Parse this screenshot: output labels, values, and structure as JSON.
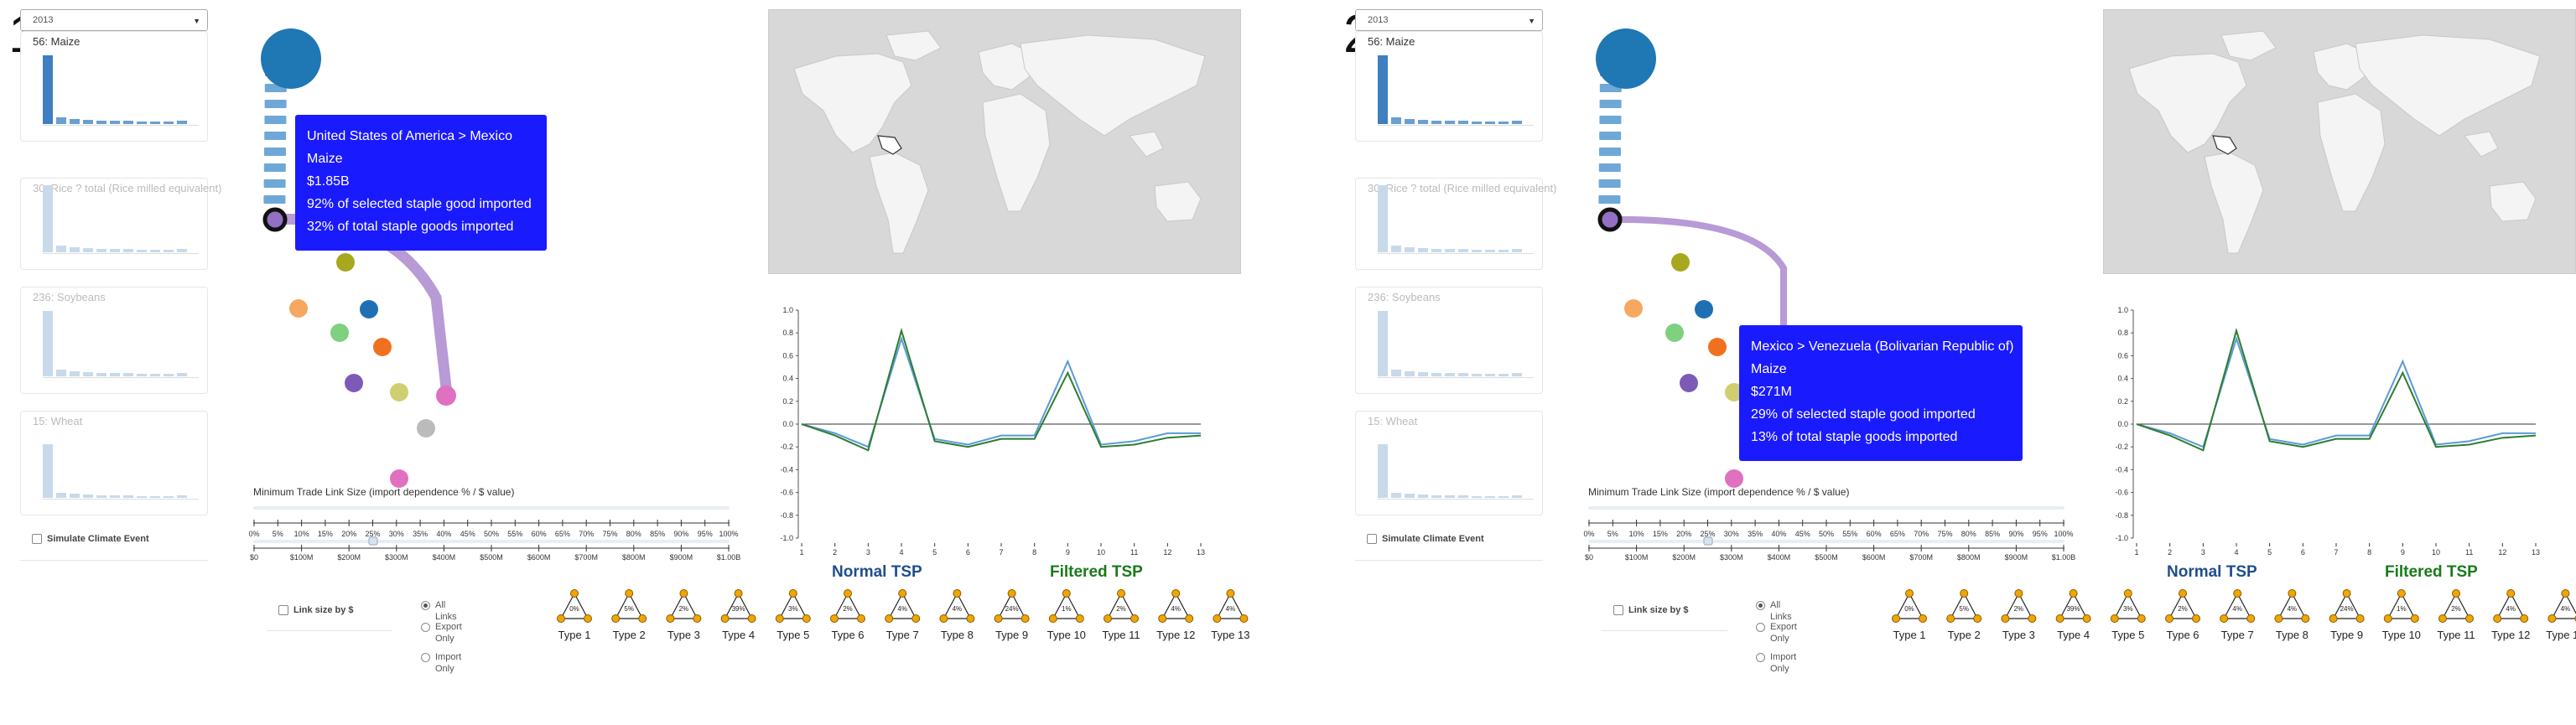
{
  "panels": [
    {
      "number": "1",
      "year": "2013",
      "crops": [
        {
          "label": "56: Maize",
          "active": true
        },
        {
          "label": "30: Rice ? total (Rice milled equivalent)",
          "active": false
        },
        {
          "label": "236: Soybeans",
          "active": false
        },
        {
          "label": "15: Wheat",
          "active": false
        }
      ],
      "simulate_label": "Simulate Climate Event",
      "tooltip": {
        "route": "United States of America > Mexico",
        "crop": "Maize",
        "value": "$1.85B",
        "pct_selected": "92% of selected staple good imported",
        "pct_total": "32% of total staple goods imported"
      }
    },
    {
      "number": "2",
      "year": "2013",
      "crops": [
        {
          "label": "56: Maize",
          "active": true
        },
        {
          "label": "30: Rice ? total (Rice milled equivalent)",
          "active": false
        },
        {
          "label": "236: Soybeans",
          "active": false
        },
        {
          "label": "15: Wheat",
          "active": false
        }
      ],
      "simulate_label": "Simulate Climate Event",
      "tooltip": {
        "route": "Mexico > Venezuela (Bolivarian Republic of)",
        "crop": "Maize",
        "value": "$271M",
        "pct_selected": "29% of selected staple good imported",
        "pct_total": "13% of total staple goods imported"
      }
    }
  ],
  "slider": {
    "title": "Minimum Trade Link Size (import dependence % / $ value)",
    "pct_ticks": [
      "0%",
      "5%",
      "10%",
      "15%",
      "20%",
      "25%",
      "30%",
      "35%",
      "40%",
      "45%",
      "50%",
      "55%",
      "60%",
      "65%",
      "70%",
      "75%",
      "80%",
      "85%",
      "90%",
      "95%",
      "100%"
    ],
    "dollar_ticks": [
      "$0",
      "$100M",
      "$200M",
      "$300M",
      "$400M",
      "$500M",
      "$600M",
      "$700M",
      "$800M",
      "$900M",
      "$1.00B"
    ]
  },
  "link_size_label": "Link size by $",
  "link_filter": {
    "options": [
      "All Links",
      "Export Only",
      "Import Only"
    ],
    "selected": "All Links"
  },
  "tsp_titles": {
    "normal": "Normal TSP",
    "filtered": "Filtered TSP"
  },
  "colors": {
    "normal_title": "#1f4e8c",
    "filtered_title": "#1a7a1a",
    "tooltip_bg": "#1a1aff",
    "maize_node": "#1f77b4",
    "flow_link": "#b89ad6",
    "line_normal": "#5b9bd5",
    "line_filtered": "#2e7d32"
  },
  "motif_types": [
    {
      "label": "Type 1",
      "pct": "0%"
    },
    {
      "label": "Type 2",
      "pct": "5%"
    },
    {
      "label": "Type 3",
      "pct": "2%"
    },
    {
      "label": "Type 4",
      "pct": "39%"
    },
    {
      "label": "Type 5",
      "pct": "3%"
    },
    {
      "label": "Type 6",
      "pct": "2%"
    },
    {
      "label": "Type 7",
      "pct": "4%"
    },
    {
      "label": "Type 8",
      "pct": "4%"
    },
    {
      "label": "Type 9",
      "pct": "24%"
    },
    {
      "label": "Type 10",
      "pct": "1%"
    },
    {
      "label": "Type 11",
      "pct": "2%"
    },
    {
      "label": "Type 12",
      "pct": "4%"
    },
    {
      "label": "Type 13",
      "pct": "4%"
    }
  ],
  "chart_data": {
    "type": "line",
    "x": [
      1,
      2,
      3,
      4,
      5,
      6,
      7,
      8,
      9,
      10,
      11,
      12,
      13
    ],
    "ylim": [
      -1.0,
      1.0
    ],
    "yticks": [
      "1.0",
      "0.8",
      "0.6",
      "0.4",
      "0.2",
      "0.0",
      "-0.2",
      "-0.4",
      "-0.6",
      "-0.8",
      "-1.0"
    ],
    "series": [
      {
        "values": [
          0.0,
          -0.08,
          -0.2,
          0.75,
          -0.13,
          -0.18,
          -0.1,
          -0.1,
          0.55,
          -0.18,
          -0.15,
          -0.08,
          -0.08
        ]
      },
      {
        "values": [
          0.0,
          -0.1,
          -0.23,
          0.82,
          -0.15,
          -0.2,
          -0.13,
          -0.13,
          0.45,
          -0.2,
          -0.18,
          -0.12,
          -0.1
        ]
      }
    ],
    "xlabel": "",
    "ylabel": "",
    "title": ""
  }
}
